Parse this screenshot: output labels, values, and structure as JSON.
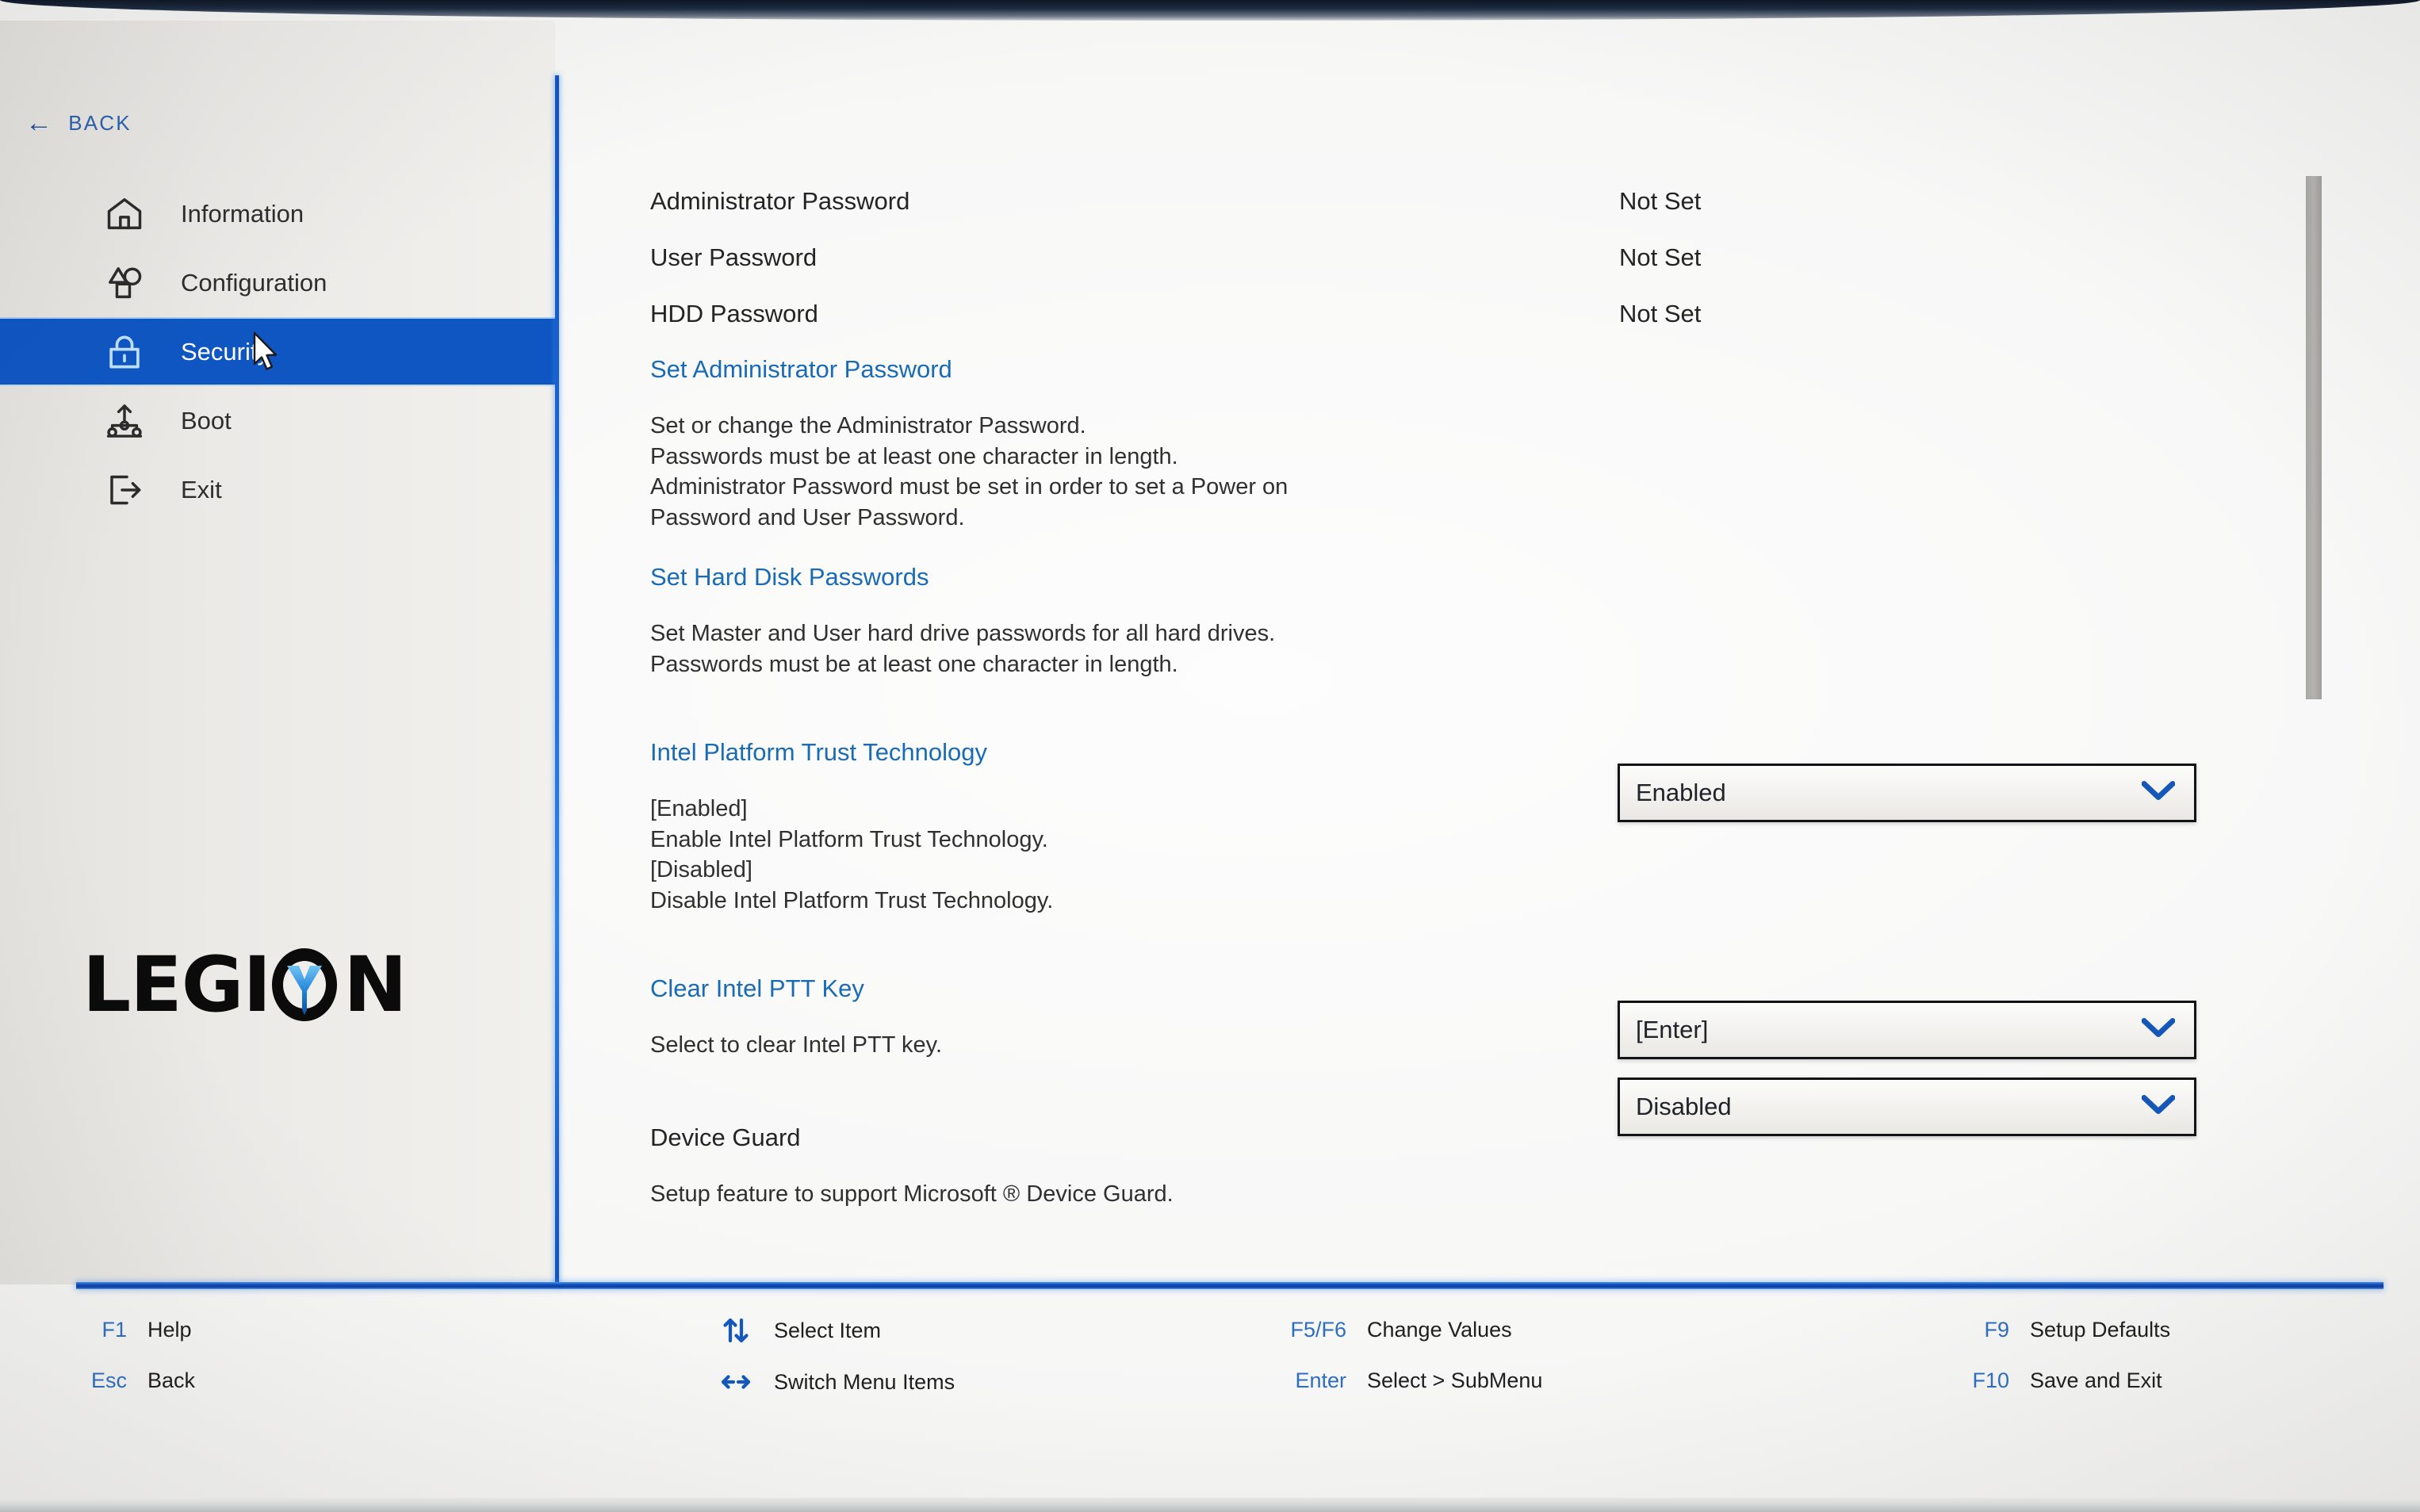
{
  "nav": {
    "back_label": "BACK",
    "items": [
      {
        "label": "Information",
        "icon": "home-icon",
        "active": false
      },
      {
        "label": "Configuration",
        "icon": "shapes-icon",
        "active": false
      },
      {
        "label": "Security",
        "icon": "lock-icon",
        "active": true
      },
      {
        "label": "Boot",
        "icon": "boot-tree-icon",
        "active": false
      },
      {
        "label": "Exit",
        "icon": "exit-icon",
        "active": false
      }
    ]
  },
  "branding": {
    "logo_text": "LEGION"
  },
  "main": {
    "status_rows": [
      {
        "label": "Administrator Password",
        "value": "Not Set"
      },
      {
        "label": "User Password",
        "value": "Not Set"
      },
      {
        "label": "HDD Password",
        "value": "Not Set"
      }
    ],
    "settings": [
      {
        "title": "Set Administrator Password",
        "title_style": "link",
        "description": "Set or change the Administrator Password.\nPasswords must be at least one character in length.\nAdministrator Password must be set in order to set a Power on\nPassword and User Password.",
        "control": null
      },
      {
        "title": "Set Hard Disk Passwords",
        "title_style": "link",
        "description": "Set Master and User hard drive passwords for all hard drives.\nPasswords must be at least one character in length.",
        "control": null
      },
      {
        "title": "Intel Platform Trust Technology",
        "title_style": "link",
        "description": "[Enabled]\nEnable Intel Platform Trust Technology.\n[Disabled]\nDisable Intel Platform Trust Technology.",
        "control": {
          "type": "dropdown",
          "value": "Enabled"
        }
      },
      {
        "title": "Clear Intel PTT Key",
        "title_style": "link",
        "description": "Select to clear Intel PTT key.",
        "control": {
          "type": "dropdown",
          "value": "[Enter]"
        }
      },
      {
        "title": "Device Guard",
        "title_style": "plain",
        "description": "Setup feature to support Microsoft ® Device Guard.",
        "control": {
          "type": "dropdown",
          "value": "Disabled"
        }
      }
    ]
  },
  "footer": {
    "shortcuts": [
      {
        "key": "F1",
        "key_icon": null,
        "label": "Help"
      },
      {
        "key": "Esc",
        "key_icon": null,
        "label": "Back"
      },
      {
        "key": "",
        "key_icon": "up-down-arrows-icon",
        "label": "Select Item"
      },
      {
        "key": "",
        "key_icon": "left-right-arrows-icon",
        "label": "Switch Menu Items"
      },
      {
        "key": "F5/F6",
        "key_icon": null,
        "label": "Change Values"
      },
      {
        "key": "Enter",
        "key_icon": null,
        "label": "Select > SubMenu"
      },
      {
        "key": "F9",
        "key_icon": null,
        "label": "Setup Defaults"
      },
      {
        "key": "F10",
        "key_icon": null,
        "label": "Save and Exit"
      }
    ]
  },
  "colors": {
    "accent_blue": "#0f56c3",
    "link_blue": "#1a6bb5",
    "footer_key_blue": "#2e6ec0",
    "text": "#242424",
    "background": "#f1f0ed"
  }
}
